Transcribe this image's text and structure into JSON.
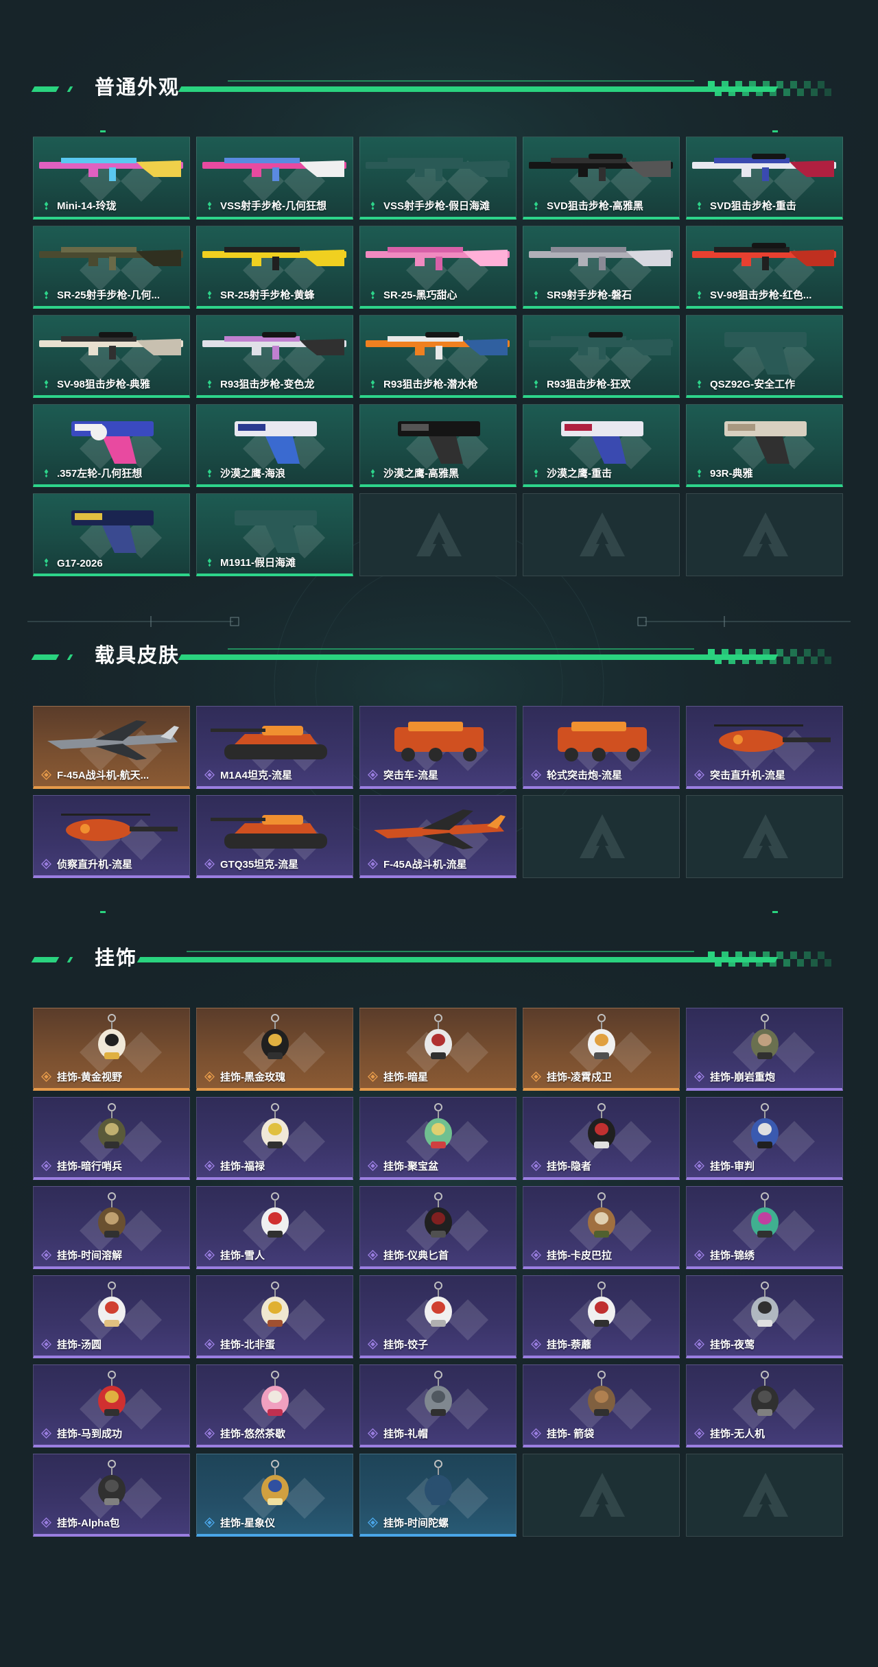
{
  "sections": [
    {
      "title": "普通外观",
      "items": [
        {
          "label": "Mini-14-玲珑",
          "rarity": "green",
          "icon": "rifle-icon",
          "palette": [
            "#e060c0",
            "#5ac8f0",
            "#f0d04a"
          ]
        },
        {
          "label": "VSS射手步枪-几何狂想",
          "rarity": "green",
          "icon": "rifle-icon",
          "palette": [
            "#e84aa0",
            "#5a8ae0",
            "#f0f0f0"
          ]
        },
        {
          "label": "VSS射手步枪-假日海滩",
          "rarity": "green",
          "icon": "rifle-icon",
          "palette": [
            "#2a5a56",
            "#2a5a56",
            "#2a5a56"
          ]
        },
        {
          "label": "SVD狙击步枪-高雅黑",
          "rarity": "green",
          "icon": "sniper-icon",
          "palette": [
            "#151515",
            "#303030",
            "#555555"
          ]
        },
        {
          "label": "SVD狙击步枪-重击",
          "rarity": "green",
          "icon": "sniper-icon",
          "palette": [
            "#e8e8f0",
            "#3a4ab0",
            "#b02040"
          ]
        },
        {
          "label": "SR-25射手步枪-几何...",
          "rarity": "green",
          "icon": "rifle-icon",
          "palette": [
            "#4a4a30",
            "#6a6a48",
            "#303020"
          ]
        },
        {
          "label": "SR-25射手步枪-黄蜂",
          "rarity": "green",
          "icon": "rifle-icon",
          "palette": [
            "#f0d020",
            "#202020",
            "#f0d020"
          ]
        },
        {
          "label": "SR-25-黑巧甜心",
          "rarity": "green",
          "icon": "rifle-icon",
          "palette": [
            "#f08ac0",
            "#d860a8",
            "#ffb0d8"
          ]
        },
        {
          "label": "SR9射手步枪-磐石",
          "rarity": "green",
          "icon": "rifle-icon",
          "palette": [
            "#b0b0b8",
            "#8a8a96",
            "#d8d8e0"
          ]
        },
        {
          "label": "SV-98狙击步枪-红色...",
          "rarity": "green",
          "icon": "sniper-icon",
          "palette": [
            "#e84030",
            "#202020",
            "#c03020"
          ]
        },
        {
          "label": "SV-98狙击步枪-典雅",
          "rarity": "green",
          "icon": "sniper-icon",
          "palette": [
            "#e8e0d0",
            "#303030",
            "#c8c0b0"
          ]
        },
        {
          "label": "R93狙击步枪-变色龙",
          "rarity": "green",
          "icon": "sniper-icon",
          "palette": [
            "#e0e0e8",
            "#c080d0",
            "#303030"
          ]
        },
        {
          "label": "R93狙击步枪-潜水枪",
          "rarity": "green",
          "icon": "sniper-icon",
          "palette": [
            "#f08020",
            "#e8e8e8",
            "#3060a0"
          ]
        },
        {
          "label": "R93狙击步枪-狂欢",
          "rarity": "green",
          "icon": "sniper-icon",
          "palette": [
            "#2a5a56",
            "#2a5a56",
            "#2a5a56"
          ]
        },
        {
          "label": "QSZ92G-安全工作",
          "rarity": "green",
          "icon": "pistol-icon",
          "palette": [
            "#2a5a56",
            "#2a5a56",
            "#2a5a56"
          ]
        },
        {
          "label": ".357左轮-几何狂想",
          "rarity": "green",
          "icon": "revolver-icon",
          "palette": [
            "#3a4ac0",
            "#e84aa0",
            "#f0f0f0"
          ]
        },
        {
          "label": "沙漠之鹰-海浪",
          "rarity": "green",
          "icon": "pistol-icon",
          "palette": [
            "#e8e8f0",
            "#3a6ad0",
            "#2a3a90"
          ]
        },
        {
          "label": "沙漠之鹰-高雅黑",
          "rarity": "green",
          "icon": "pistol-icon",
          "palette": [
            "#151515",
            "#303030",
            "#555555"
          ]
        },
        {
          "label": "沙漠之鹰-重击",
          "rarity": "green",
          "icon": "pistol-icon",
          "palette": [
            "#e8e8f0",
            "#3a4ab0",
            "#b02040"
          ]
        },
        {
          "label": "93R-典雅",
          "rarity": "green",
          "icon": "pistol-icon",
          "palette": [
            "#d8d0c0",
            "#303030",
            "#a89880"
          ]
        },
        {
          "label": "G17-2026",
          "rarity": "green",
          "icon": "pistol-icon",
          "palette": [
            "#1a2450",
            "#3a4a90",
            "#e0c040"
          ]
        },
        {
          "label": "M1911-假日海滩",
          "rarity": "green",
          "icon": "pistol-icon",
          "palette": [
            "#2a5a56",
            "#2a5a56",
            "#2a5a56"
          ]
        },
        {
          "empty": true
        },
        {
          "empty": true
        },
        {
          "empty": true
        }
      ]
    },
    {
      "title": "载具皮肤",
      "items": [
        {
          "label": "F-45A战斗机-航天...",
          "rarity": "orange",
          "icon": "jet-icon",
          "palette": [
            "#303438",
            "#8a9098",
            "#d0d4d8"
          ]
        },
        {
          "label": "M1A4坦克-流星",
          "rarity": "purple",
          "icon": "tank-icon",
          "palette": [
            "#2a2a2a",
            "#d05020",
            "#f09030"
          ]
        },
        {
          "label": "突击车-流星",
          "rarity": "purple",
          "icon": "vehicle-icon",
          "palette": [
            "#2a2a2a",
            "#d05020",
            "#f09030"
          ]
        },
        {
          "label": "轮式突击炮-流星",
          "rarity": "purple",
          "icon": "vehicle-icon",
          "palette": [
            "#2a2a2a",
            "#d05020",
            "#f09030"
          ]
        },
        {
          "label": "突击直升机-流星",
          "rarity": "purple",
          "icon": "helicopter-icon",
          "palette": [
            "#2a2a2a",
            "#d05020",
            "#f09030"
          ]
        },
        {
          "label": "侦察直升机-流星",
          "rarity": "purple",
          "icon": "helicopter-icon",
          "palette": [
            "#2a2a2a",
            "#d05020",
            "#f09030"
          ]
        },
        {
          "label": "GTQ35坦克-流星",
          "rarity": "purple",
          "icon": "tank-icon",
          "palette": [
            "#2a2a2a",
            "#d05020",
            "#f09030"
          ]
        },
        {
          "label": "F-45A战斗机-流星",
          "rarity": "purple",
          "icon": "jet-icon",
          "palette": [
            "#2a2a2a",
            "#d05020",
            "#f09030"
          ]
        },
        {
          "empty": true
        },
        {
          "empty": true
        }
      ]
    },
    {
      "title": "挂饰",
      "items": [
        {
          "label": "挂饰-黄金视野",
          "rarity": "orange",
          "icon": "charm-icon",
          "palette": [
            "#f0e8d8",
            "#202020",
            "#e0b040"
          ]
        },
        {
          "label": "挂饰-黑金玫瑰",
          "rarity": "orange",
          "icon": "charm-icon",
          "palette": [
            "#202020",
            "#e0b040",
            "#303030"
          ]
        },
        {
          "label": "挂饰-暗星",
          "rarity": "orange",
          "icon": "charm-icon",
          "palette": [
            "#e8e8e8",
            "#b03030",
            "#303030"
          ]
        },
        {
          "label": "挂饰-凌霄戍卫",
          "rarity": "orange",
          "icon": "charm-icon",
          "palette": [
            "#f0f0f0",
            "#e0a040",
            "#505050"
          ]
        },
        {
          "label": "挂饰-崩岩重炮",
          "rarity": "purple",
          "icon": "charm-icon",
          "palette": [
            "#6a7050",
            "#c0a080",
            "#303030"
          ]
        },
        {
          "label": "挂饰-暗行哨兵",
          "rarity": "purple",
          "icon": "charm-icon",
          "palette": [
            "#5a5a3a",
            "#c0b070",
            "#303030"
          ]
        },
        {
          "label": "挂饰-福禄",
          "rarity": "purple",
          "icon": "charm-icon",
          "palette": [
            "#f0e8d8",
            "#e0c040",
            "#303030"
          ]
        },
        {
          "label": "挂饰-聚宝盆",
          "rarity": "purple",
          "icon": "charm-icon",
          "palette": [
            "#70c090",
            "#e0d070",
            "#d04040"
          ]
        },
        {
          "label": "挂饰-隐者",
          "rarity": "purple",
          "icon": "charm-icon",
          "palette": [
            "#202020",
            "#c03030",
            "#e0e0e0"
          ]
        },
        {
          "label": "挂饰-审判",
          "rarity": "purple",
          "icon": "charm-icon",
          "palette": [
            "#3a5ab0",
            "#e0e0e0",
            "#202020"
          ]
        },
        {
          "label": "挂饰-时间溶解",
          "rarity": "purple",
          "icon": "charm-icon",
          "palette": [
            "#6a5030",
            "#c0a070",
            "#303030"
          ]
        },
        {
          "label": "挂饰-雪人",
          "rarity": "purple",
          "icon": "charm-icon",
          "palette": [
            "#f0f0f0",
            "#d03030",
            "#303030"
          ]
        },
        {
          "label": "挂饰-仪典匕首",
          "rarity": "purple",
          "icon": "charm-icon",
          "palette": [
            "#202020",
            "#802020",
            "#505050"
          ]
        },
        {
          "label": "挂饰-卡皮巴拉",
          "rarity": "purple",
          "icon": "charm-icon",
          "palette": [
            "#a07040",
            "#e0d0b0",
            "#506030"
          ]
        },
        {
          "label": "挂饰-锦绣",
          "rarity": "purple",
          "icon": "charm-icon",
          "palette": [
            "#40b090",
            "#c040a0",
            "#303030"
          ]
        },
        {
          "label": "挂饰-汤圆",
          "rarity": "purple",
          "icon": "charm-icon",
          "palette": [
            "#f0f0f0",
            "#d04030",
            "#e0c080"
          ]
        },
        {
          "label": "挂饰-北非蛋",
          "rarity": "purple",
          "icon": "charm-icon",
          "palette": [
            "#f0e8d0",
            "#e0b030",
            "#a05030"
          ]
        },
        {
          "label": "挂饰-饺子",
          "rarity": "purple",
          "icon": "charm-icon",
          "palette": [
            "#f0f0f0",
            "#d04030",
            "#b0b0b0"
          ]
        },
        {
          "label": "挂饰-萘蘼",
          "rarity": "purple",
          "icon": "charm-icon",
          "palette": [
            "#f0f0f0",
            "#c03030",
            "#303030"
          ]
        },
        {
          "label": "挂饰-夜莺",
          "rarity": "purple",
          "icon": "charm-icon",
          "palette": [
            "#b0b8c0",
            "#303030",
            "#e0e0e0"
          ]
        },
        {
          "label": "挂饰-马到成功",
          "rarity": "purple",
          "icon": "charm-icon",
          "palette": [
            "#d03030",
            "#e0b040",
            "#303030"
          ]
        },
        {
          "label": "挂饰-悠然茶歇",
          "rarity": "purple",
          "icon": "charm-icon",
          "palette": [
            "#f0a0c0",
            "#f0e8e0",
            "#c03050"
          ]
        },
        {
          "label": "挂饰-礼帽",
          "rarity": "purple",
          "icon": "charm-icon",
          "palette": [
            "#808890",
            "#505860",
            "#303030"
          ]
        },
        {
          "label": "挂饰- 箭袋",
          "rarity": "purple",
          "icon": "charm-icon",
          "palette": [
            "#806040",
            "#b08050",
            "#303030"
          ]
        },
        {
          "label": "挂饰-无人机",
          "rarity": "purple",
          "icon": "charm-icon",
          "palette": [
            "#303030",
            "#505050",
            "#808080"
          ]
        },
        {
          "label": "挂饰-Alpha包",
          "rarity": "purple",
          "icon": "charm-icon",
          "palette": [
            "#303030",
            "#505050",
            "#808080"
          ]
        },
        {
          "label": "挂饰-星象仪",
          "rarity": "blue",
          "icon": "charm-icon",
          "palette": [
            "#d0a040",
            "#3050a0",
            "#f0e0a0"
          ]
        },
        {
          "label": "挂饰-时间陀螺",
          "rarity": "blue",
          "icon": "charm-icon",
          "palette": [
            "#2a5070",
            "#2a5070",
            "#2a5070"
          ]
        },
        {
          "empty": true
        },
        {
          "empty": true
        }
      ]
    }
  ],
  "colors": {
    "accent": "#2ad37f",
    "green": "#2dd48a",
    "purple": "#9a7ee0",
    "orange": "#e59a4a",
    "blue": "#4aa6e8",
    "background": "#17242a"
  }
}
